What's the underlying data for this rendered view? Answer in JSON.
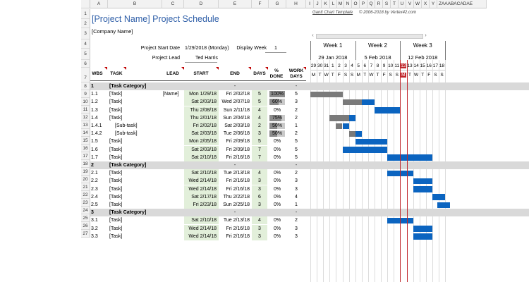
{
  "columns": [
    "A",
    "B",
    "C",
    "D",
    "E",
    "F",
    "G",
    "H",
    "I",
    "J",
    "K",
    "L",
    "M",
    "N",
    "O",
    "P",
    "Q",
    "R",
    "S",
    "T",
    "U",
    "V",
    "W",
    "X",
    "Y",
    "Z",
    "AA",
    "AB",
    "AC",
    "AD",
    "AE"
  ],
  "column_tail": "ZAAABACADAE",
  "title": "[Project Name] Project Schedule",
  "company": "[Company Name]",
  "template_link": "Gantt Chart Template",
  "copyright": "© 2006-2018 by Vertex42.com",
  "project_start_label": "Project Start Date",
  "project_start_value": "1/29/2018 (Monday)",
  "display_week_label": "Display Week",
  "display_week_value": "1",
  "project_lead_label": "Project Lead",
  "project_lead_value": "Ted Harris",
  "headers": {
    "wbs": "WBS",
    "task": "TASK",
    "lead": "LEAD",
    "start": "START",
    "end": "END",
    "days": "DAYS",
    "pct1": "%",
    "pct2": "DONE",
    "work1": "WORK",
    "work2": "DAYS"
  },
  "weeks": [
    {
      "label": "Week 1",
      "date": "29 Jan 2018"
    },
    {
      "label": "Week 2",
      "date": "5 Feb 2018"
    },
    {
      "label": "Week 3",
      "date": "12 Feb 2018"
    }
  ],
  "days": [
    "29",
    "30",
    "31",
    "1",
    "2",
    "3",
    "4",
    "5",
    "6",
    "7",
    "8",
    "9",
    "10",
    "11",
    "12",
    "13",
    "14",
    "15",
    "16",
    "17",
    "18"
  ],
  "dows": [
    "M",
    "T",
    "W",
    "T",
    "F",
    "S",
    "S",
    "M",
    "T",
    "W",
    "T",
    "F",
    "S",
    "S",
    "M",
    "T",
    "W",
    "T",
    "F",
    "S",
    "S"
  ],
  "today_index": 14,
  "row_numbers": [
    "1",
    "2",
    "3",
    "4",
    "5",
    "6",
    "7",
    "8",
    "9",
    "10",
    "11",
    "12",
    "13",
    "14",
    "15",
    "16",
    "17",
    "18",
    "19",
    "20",
    "21",
    "22",
    "23",
    "24",
    "25",
    "26",
    "27"
  ],
  "rows": [
    {
      "type": "cat",
      "wbs": "1",
      "task": "[Task Category]",
      "end": "-",
      "work": "-"
    },
    {
      "wbs": "1.1",
      "task": "[Task]",
      "lead": "[Name]",
      "start": "Mon 1/29/18",
      "end": "Fri 2/02/18",
      "days": "5",
      "pct": "100%",
      "pctv": 1.0,
      "work": "5",
      "bar": [
        0,
        5
      ],
      "color": "grey"
    },
    {
      "wbs": "1.2",
      "task": "[Task]",
      "lead": "",
      "start": "Sat 2/03/18",
      "end": "Wed 2/07/18",
      "days": "5",
      "pct": "60%",
      "pctv": 0.6,
      "work": "3",
      "bar": [
        5,
        10
      ],
      "color": "mixed",
      "split": 8
    },
    {
      "wbs": "1.3",
      "task": "[Task]",
      "lead": "",
      "start": "Thu 2/08/18",
      "end": "Sun 2/11/18",
      "days": "4",
      "pct": "0%",
      "pctv": 0,
      "work": "2",
      "bar": [
        10,
        14
      ],
      "color": "blue"
    },
    {
      "wbs": "1.4",
      "task": "[Task]",
      "lead": "",
      "start": "Thu 2/01/18",
      "end": "Sun 2/04/18",
      "days": "4",
      "pct": "75%",
      "pctv": 0.75,
      "work": "2",
      "bar": [
        3,
        7
      ],
      "color": "mixed",
      "split": 6
    },
    {
      "wbs": "1.4.1",
      "task": "[Sub-task]",
      "lead": "",
      "start": "Fri 2/02/18",
      "end": "Sat 2/03/18",
      "days": "2",
      "pct": "50%",
      "pctv": 0.5,
      "work": "1",
      "bar": [
        4,
        6
      ],
      "color": "mixed",
      "split": 5
    },
    {
      "wbs": "1.4.2",
      "task": "[Sub-task]",
      "lead": "",
      "start": "Sat 2/03/18",
      "end": "Tue 2/06/18",
      "days": "3",
      "pct": "50%",
      "pctv": 0.5,
      "work": "2",
      "bar": [
        6,
        8
      ],
      "color": "mixed",
      "split": 7
    },
    {
      "wbs": "1.5",
      "task": "[Task]",
      "lead": "",
      "start": "Mon 2/05/18",
      "end": "Fri 2/09/18",
      "days": "5",
      "pct": "0%",
      "pctv": 0,
      "work": "5",
      "bar": [
        7,
        12
      ],
      "color": "blue"
    },
    {
      "wbs": "1.6",
      "task": "[Task]",
      "lead": "",
      "start": "Sat 2/03/18",
      "end": "Fri 2/09/18",
      "days": "7",
      "pct": "0%",
      "pctv": 0,
      "work": "5",
      "bar": [
        5,
        12
      ],
      "color": "blue"
    },
    {
      "wbs": "1.7",
      "task": "[Task]",
      "lead": "",
      "start": "Sat 2/10/18",
      "end": "Fri 2/16/18",
      "days": "7",
      "pct": "0%",
      "pctv": 0,
      "work": "5",
      "bar": [
        12,
        19
      ],
      "color": "blue"
    },
    {
      "type": "cat",
      "wbs": "2",
      "task": "[Task Category]",
      "end": "-",
      "work": "-"
    },
    {
      "wbs": "2.1",
      "task": "[Task]",
      "lead": "",
      "start": "Sat 2/10/18",
      "end": "Tue 2/13/18",
      "days": "4",
      "pct": "0%",
      "pctv": 0,
      "work": "2",
      "bar": [
        12,
        16
      ],
      "color": "blue"
    },
    {
      "wbs": "2.2",
      "task": "[Task]",
      "lead": "",
      "start": "Wed 2/14/18",
      "end": "Fri 2/16/18",
      "days": "3",
      "pct": "0%",
      "pctv": 0,
      "work": "3",
      "bar": [
        16,
        19
      ],
      "color": "blue"
    },
    {
      "wbs": "2.3",
      "task": "[Task]",
      "lead": "",
      "start": "Wed 2/14/18",
      "end": "Fri 2/16/18",
      "days": "3",
      "pct": "0%",
      "pctv": 0,
      "work": "3",
      "bar": [
        16,
        19
      ],
      "color": "blue"
    },
    {
      "wbs": "2.4",
      "task": "[Task]",
      "lead": "",
      "start": "Sat 2/17/18",
      "end": "Thu 2/22/18",
      "days": "6",
      "pct": "0%",
      "pctv": 0,
      "work": "4",
      "bar": [
        19,
        21
      ],
      "color": "blue"
    },
    {
      "wbs": "2.5",
      "task": "[Task]",
      "lead": "",
      "start": "Fri 2/23/18",
      "end": "Sun 2/25/18",
      "days": "3",
      "pct": "0%",
      "pctv": 0,
      "work": "1",
      "bar": null,
      "color": "blue"
    },
    {
      "type": "cat",
      "wbs": "3",
      "task": "[Task Category]",
      "end": "-",
      "work": "-"
    },
    {
      "wbs": "3.1",
      "task": "[Task]",
      "lead": "",
      "start": "Sat 2/10/18",
      "end": "Tue 2/13/18",
      "days": "4",
      "pct": "0%",
      "pctv": 0,
      "work": "2",
      "bar": [
        12,
        16
      ],
      "color": "blue"
    },
    {
      "wbs": "3.2",
      "task": "[Task]",
      "lead": "",
      "start": "Wed 2/14/18",
      "end": "Fri 2/16/18",
      "days": "3",
      "pct": "0%",
      "pctv": 0,
      "work": "3",
      "bar": [
        16,
        19
      ],
      "color": "blue"
    },
    {
      "wbs": "3.3",
      "task": "[Task]",
      "lead": "",
      "start": "Wed 2/14/18",
      "end": "Fri 2/16/18",
      "days": "3",
      "pct": "0%",
      "pctv": 0,
      "work": "3",
      "bar": [
        16,
        19
      ],
      "color": "blue"
    }
  ],
  "colors": {
    "blue": "#0b64c0",
    "grey": "#7a7a7a",
    "today": "#c0262b",
    "category": "#d9d9d9",
    "date_fill": "#e2efda"
  }
}
